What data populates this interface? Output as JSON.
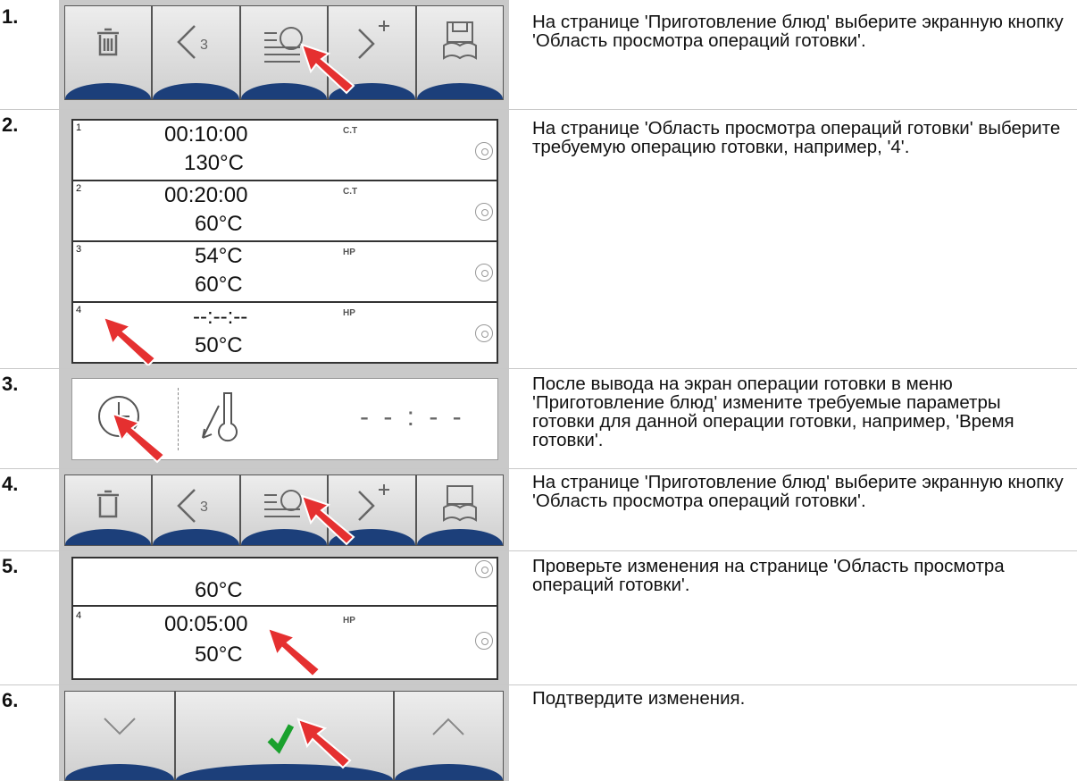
{
  "steps": [
    {
      "number": "1.",
      "text": "На странице 'Приготовление блюд' выберите эк­ранную кнопку 'Область просмотра операций го­товки'."
    },
    {
      "number": "2.",
      "text": "На странице 'Область просмотра операций го­товки' выберите требуемую операцию готовки, например, '4'."
    },
    {
      "number": "3.",
      "text": "После вывода на экран операции готовки в ме­ню 'Приготовление блюд' измените требуемые параметры готовки для данной операции готов­ки, например, 'Время готовки'."
    },
    {
      "number": "4.",
      "text": "На странице 'Приготовление блюд' выберите эк­ранную кнопку 'Область просмотра операций го­товки'."
    },
    {
      "number": "5.",
      "text": "Проверьте изменения на странице 'Область просмотра операций готовки'."
    },
    {
      "number": "6.",
      "text": "Подтвердите изменения."
    }
  ],
  "toolbar": {
    "back_count": "3"
  },
  "ops_list": [
    {
      "index": "1",
      "time": "00:10:00",
      "temp": "130°C",
      "mode": "C.T"
    },
    {
      "index": "2",
      "time": "00:20:00",
      "temp": "60°C",
      "mode": "C.T"
    },
    {
      "index": "3",
      "time": "54°C",
      "temp": "60°C",
      "mode": "HP"
    },
    {
      "index": "4",
      "time": "--:--:--",
      "temp": "50°C",
      "mode": "HP"
    }
  ],
  "time_display": "- - : - -",
  "ops_list_updated": [
    {
      "index": "",
      "time": "",
      "temp": "60°C",
      "mode": ""
    },
    {
      "index": "4",
      "time": "00:05:00",
      "temp": "50°C",
      "mode": "HP"
    }
  ]
}
